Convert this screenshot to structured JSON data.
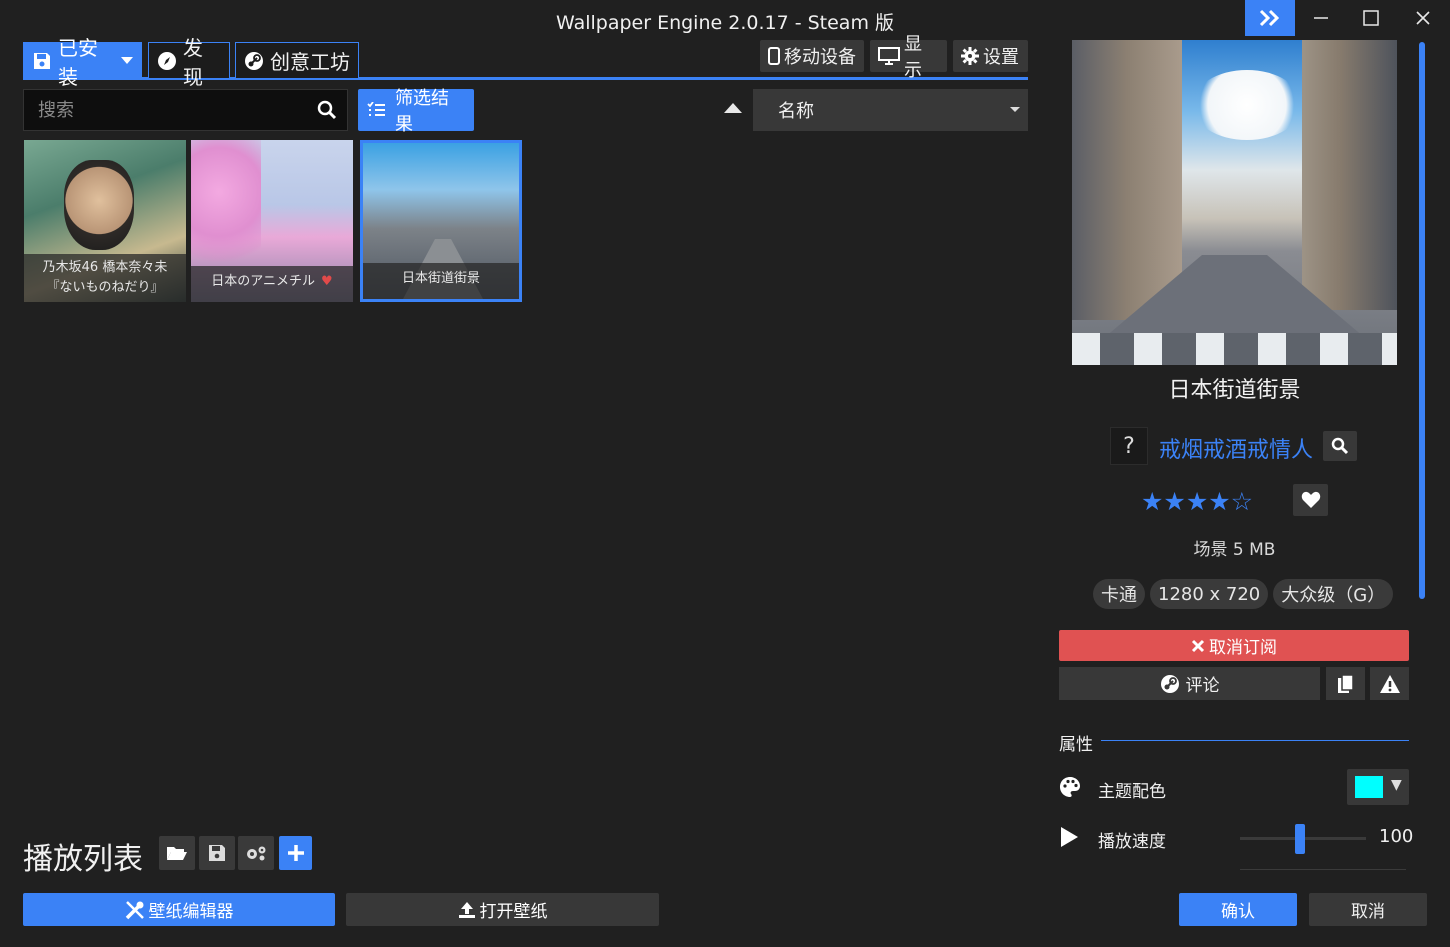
{
  "window": {
    "title": "Wallpaper Engine 2.0.17 - Steam 版"
  },
  "tabs": {
    "installed": "已安装",
    "discover": "发现",
    "workshop": "创意工坊"
  },
  "toolbar": {
    "mobile": "移动设备",
    "display": "显示",
    "settings": "设置"
  },
  "search": {
    "placeholder": "搜索",
    "value": ""
  },
  "filter": {
    "label": "筛选结果"
  },
  "sort": {
    "selected": "名称"
  },
  "wallpapers": [
    {
      "caption_line1": "乃木坂46 橋本奈々未",
      "caption_line2": "『ないものねだり』"
    },
    {
      "caption": "日本のアニメチル"
    },
    {
      "caption": "日本街道街景"
    }
  ],
  "playlist": {
    "title": "播放列表"
  },
  "bottom": {
    "editor": "壁纸编辑器",
    "open_wallpaper": "打开壁纸",
    "confirm": "确认",
    "cancel": "取消"
  },
  "details": {
    "title": "日本街道街景",
    "author_avatar": "?",
    "author": "戒烟戒酒戒情人",
    "rating_filled": 4,
    "rating_max": 5,
    "stars_display": "★★★★☆",
    "meta": "场景 5 MB",
    "tags": [
      "卡通",
      "1280 x 720",
      "大众级（G）"
    ],
    "unsubscribe": "取消订阅",
    "comment": "评论"
  },
  "properties": {
    "header": "属性",
    "theme_color_label": "主题配色",
    "theme_color_value": "#00ffff",
    "speed_label": "播放速度",
    "speed_value": "100"
  },
  "colors": {
    "accent": "#3b82f6",
    "danger": "#e05252",
    "background": "#202020"
  }
}
